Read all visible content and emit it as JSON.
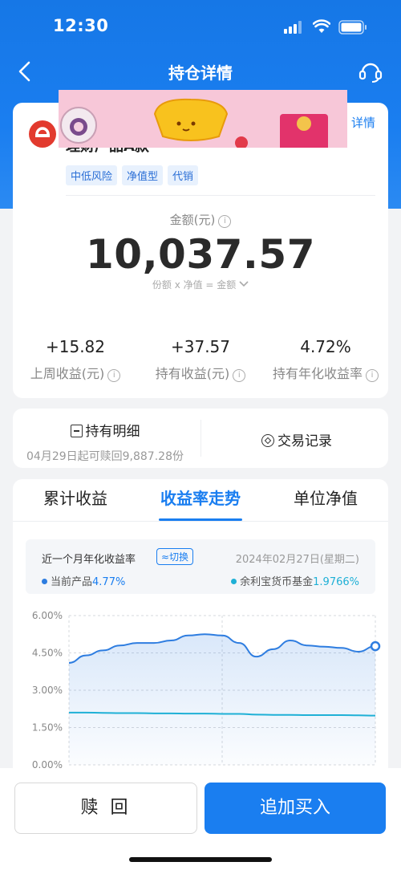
{
  "status_bar": {
    "time": "12:30"
  },
  "nav": {
    "title": "持仓详情"
  },
  "product": {
    "name": "理财产品A款",
    "detail_link": "详情",
    "tags": [
      "中低风险",
      "净值型",
      "代销"
    ]
  },
  "amount": {
    "label": "金额(元)",
    "value": "10,037.57",
    "formula": "份额 x 净值 = 金额"
  },
  "stats": [
    {
      "value": "+15.82",
      "label": "上周收益(元)"
    },
    {
      "value": "+37.57",
      "label": "持有收益(元)"
    },
    {
      "value": "4.72%",
      "label": "持有年化收益率"
    }
  ],
  "holdings": {
    "title": "持有明细",
    "subtitle": "04月29日起可赎回9,887.28份",
    "records": "交易记录"
  },
  "tabs": [
    "累计收益",
    "收益率走势",
    "单位净值"
  ],
  "active_tab": 1,
  "legend": {
    "title": "近一个月年化收益率",
    "switch": "≈切换",
    "date": "2024年02月27日(星期二)",
    "series_a_label": "当前产品",
    "series_a_value": "4.77%",
    "series_b_label": "余利宝货币基金",
    "series_b_value": "1.9766%"
  },
  "colors": {
    "primary": "#1a7ef0",
    "series_a": "#2e7de0",
    "series_b": "#1fb0d6"
  },
  "chart_data": {
    "type": "line",
    "y_ticks": [
      "6.00%",
      "4.50%",
      "3.00%",
      "1.50%",
      "0.00%"
    ],
    "ylim": [
      0,
      6
    ],
    "series": [
      {
        "name": "当前产品",
        "values": [
          4.1,
          4.4,
          4.6,
          4.8,
          4.9,
          4.9,
          5.0,
          5.2,
          5.25,
          5.2,
          4.9,
          4.35,
          4.65,
          5.0,
          4.8,
          4.75,
          4.7,
          4.55,
          4.77
        ]
      },
      {
        "name": "余利宝货币基金",
        "values": [
          2.1,
          2.1,
          2.09,
          2.08,
          2.08,
          2.07,
          2.07,
          2.06,
          2.06,
          2.05,
          2.05,
          2.02,
          2.01,
          2.01,
          2.0,
          2.0,
          2.0,
          1.99,
          1.98
        ]
      }
    ]
  },
  "buttons": {
    "redeem": "赎 回",
    "buy": "追加买入"
  }
}
